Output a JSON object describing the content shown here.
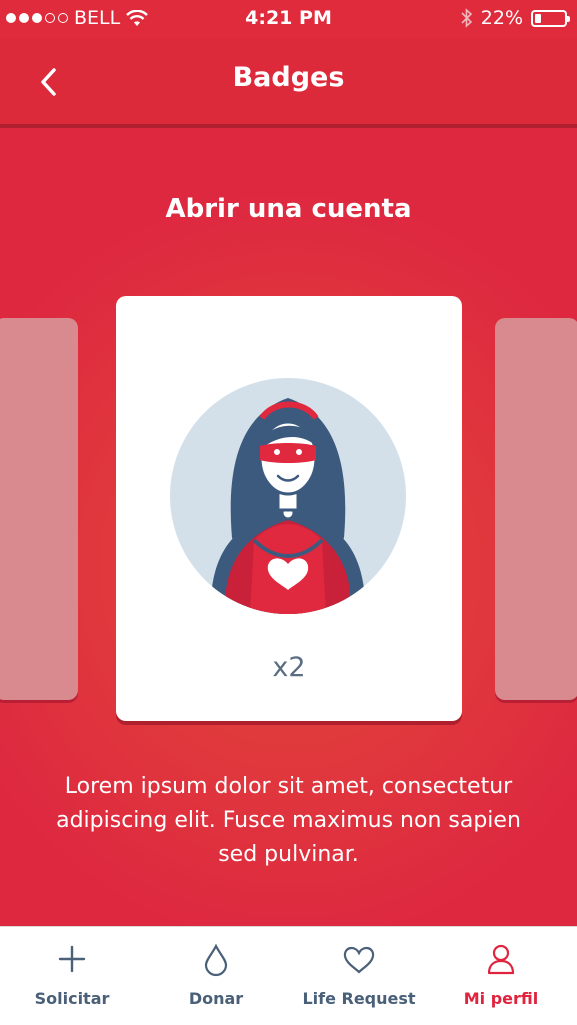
{
  "status_bar": {
    "carrier": "BELL",
    "time": "4:21 PM",
    "battery": "22%",
    "battery_level": 0.22,
    "signal_bars_filled": 3,
    "signal_bars_total": 5
  },
  "nav": {
    "title": "Badges",
    "back_icon": "chevron-left-icon"
  },
  "badge": {
    "title": "Abrir una cuenta",
    "count_label": "x2",
    "illustration": "superhero-woman-icon",
    "description": "Lorem ipsum dolor sit amet, consectetur adipiscing elit. Fusce maximus non sapien sed pulvinar."
  },
  "tabs": [
    {
      "label": "Solicitar",
      "icon": "plus-icon",
      "active": false
    },
    {
      "label": "Donar",
      "icon": "drop-icon",
      "active": false
    },
    {
      "label": "Life Request",
      "icon": "heart-icon",
      "active": false
    },
    {
      "label": "Mi perfil",
      "icon": "user-icon",
      "active": true
    }
  ],
  "colors": {
    "primary_red": "#de2840",
    "tab_active": "#e0233f",
    "tab_inactive": "#4a6079",
    "avatar_bg": "#d3e0ea",
    "hair": "#3c5a7e"
  }
}
